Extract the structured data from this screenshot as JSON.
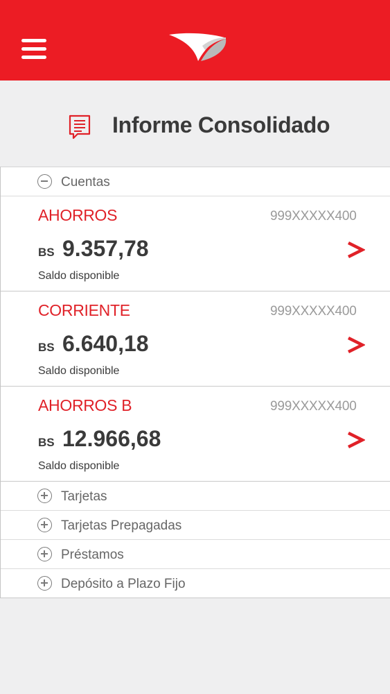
{
  "header": {
    "menu_icon": "hamburger-menu-icon",
    "logo_icon": "bank-logo-icon",
    "brand_color": "#ec1c24"
  },
  "page": {
    "title": "Informe Consolidado",
    "title_icon": "document-icon"
  },
  "cuentas": {
    "label": "Cuentas",
    "expanded": true,
    "accounts": [
      {
        "type": "AHORROS",
        "number": "999XXXXX400",
        "currency": "BS",
        "balance": "9.357,78",
        "balance_label": "Saldo disponible"
      },
      {
        "type": "CORRIENTE",
        "number": "999XXXXX400",
        "currency": "BS",
        "balance": "6.640,18",
        "balance_label": "Saldo disponible"
      },
      {
        "type": "AHORROS B",
        "number": "999XXXXX400",
        "currency": "BS",
        "balance": "12.966,68",
        "balance_label": "Saldo disponible"
      }
    ]
  },
  "sections": [
    {
      "label": "Tarjetas",
      "expanded": false
    },
    {
      "label": "Tarjetas Prepagadas",
      "expanded": false
    },
    {
      "label": "Préstamos",
      "expanded": false
    },
    {
      "label": "Depósito a Plazo Fijo",
      "expanded": false
    }
  ],
  "colors": {
    "accent": "#e02128",
    "text": "#3a3a3a",
    "muted": "#9a9a9a",
    "background": "#efeff0"
  }
}
